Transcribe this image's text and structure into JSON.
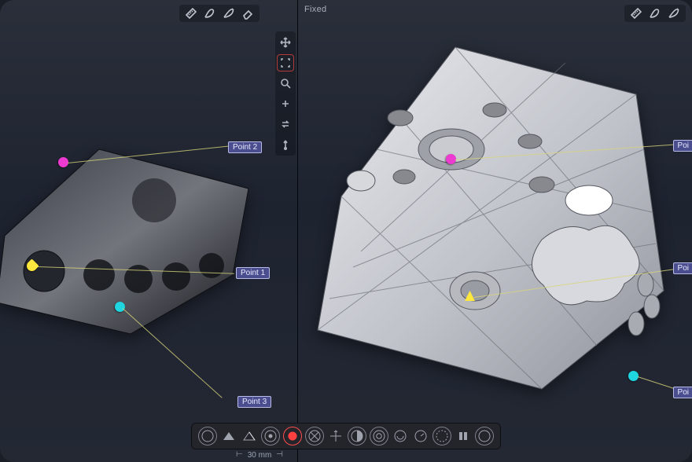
{
  "viewports": {
    "left": {
      "title": ""
    },
    "right": {
      "title": "Fixed"
    }
  },
  "annotations": {
    "left": {
      "p1": "Point 1",
      "p2": "Point 2",
      "p3": "Point 3"
    },
    "right": {
      "p1": "Poi",
      "p2": "Poi",
      "p3": "Poi"
    }
  },
  "scale": {
    "label": "30 mm"
  },
  "top_tools": {
    "measure": "measure-icon",
    "sketch": "sketch-icon",
    "pen": "pen-icon",
    "eraser": "eraser-icon"
  },
  "nav_tools": {
    "move": "move-icon",
    "fit": "fit-icon",
    "zoom": "zoom-icon",
    "cross": "add-icon",
    "swap": "swap-icon",
    "orient": "orient-icon"
  },
  "command_bar_count": 14
}
